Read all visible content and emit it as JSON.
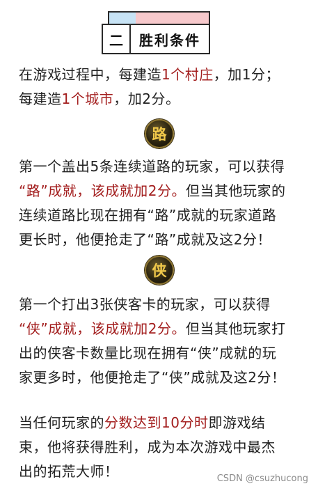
{
  "heading": {
    "number": "二",
    "title": "胜利条件"
  },
  "intro": {
    "line1": [
      "在游戏过程中，每建造",
      "1个村庄",
      "，加1分；"
    ],
    "line2": [
      "每建造",
      "1个城市",
      "，加2分。"
    ]
  },
  "road": {
    "badge": "路",
    "lines": [
      [
        "第一个盖出5条连续道路的玩家，可以获得"
      ],
      [
        "“路”成就，该成就加2分。",
        "但当其他玩家的"
      ],
      [
        "连续道路比现在拥有“路”成就的玩家道路"
      ],
      [
        "更长时，他便抢走了“路”成就及这2分！"
      ]
    ]
  },
  "knight": {
    "badge": "侠",
    "lines": [
      [
        "第一个打出3张侠客卡的玩家，可以获得"
      ],
      [
        "“侠”成就，该成就加2分。",
        "但当其他玩家打"
      ],
      [
        "出的侠客卡数量比现在拥有“侠”成就的玩"
      ],
      [
        "家更多时，他便抢走了“侠”成就及这2分！"
      ]
    ]
  },
  "ending": {
    "line1": [
      "当任何玩家的",
      "分数达到10分时",
      "即游戏结"
    ],
    "line2": "束，他将获得胜利，成为本次游戏中最杰",
    "line3": "出的拓荒大师！"
  },
  "watermark": "CSDN @csuzhucong"
}
